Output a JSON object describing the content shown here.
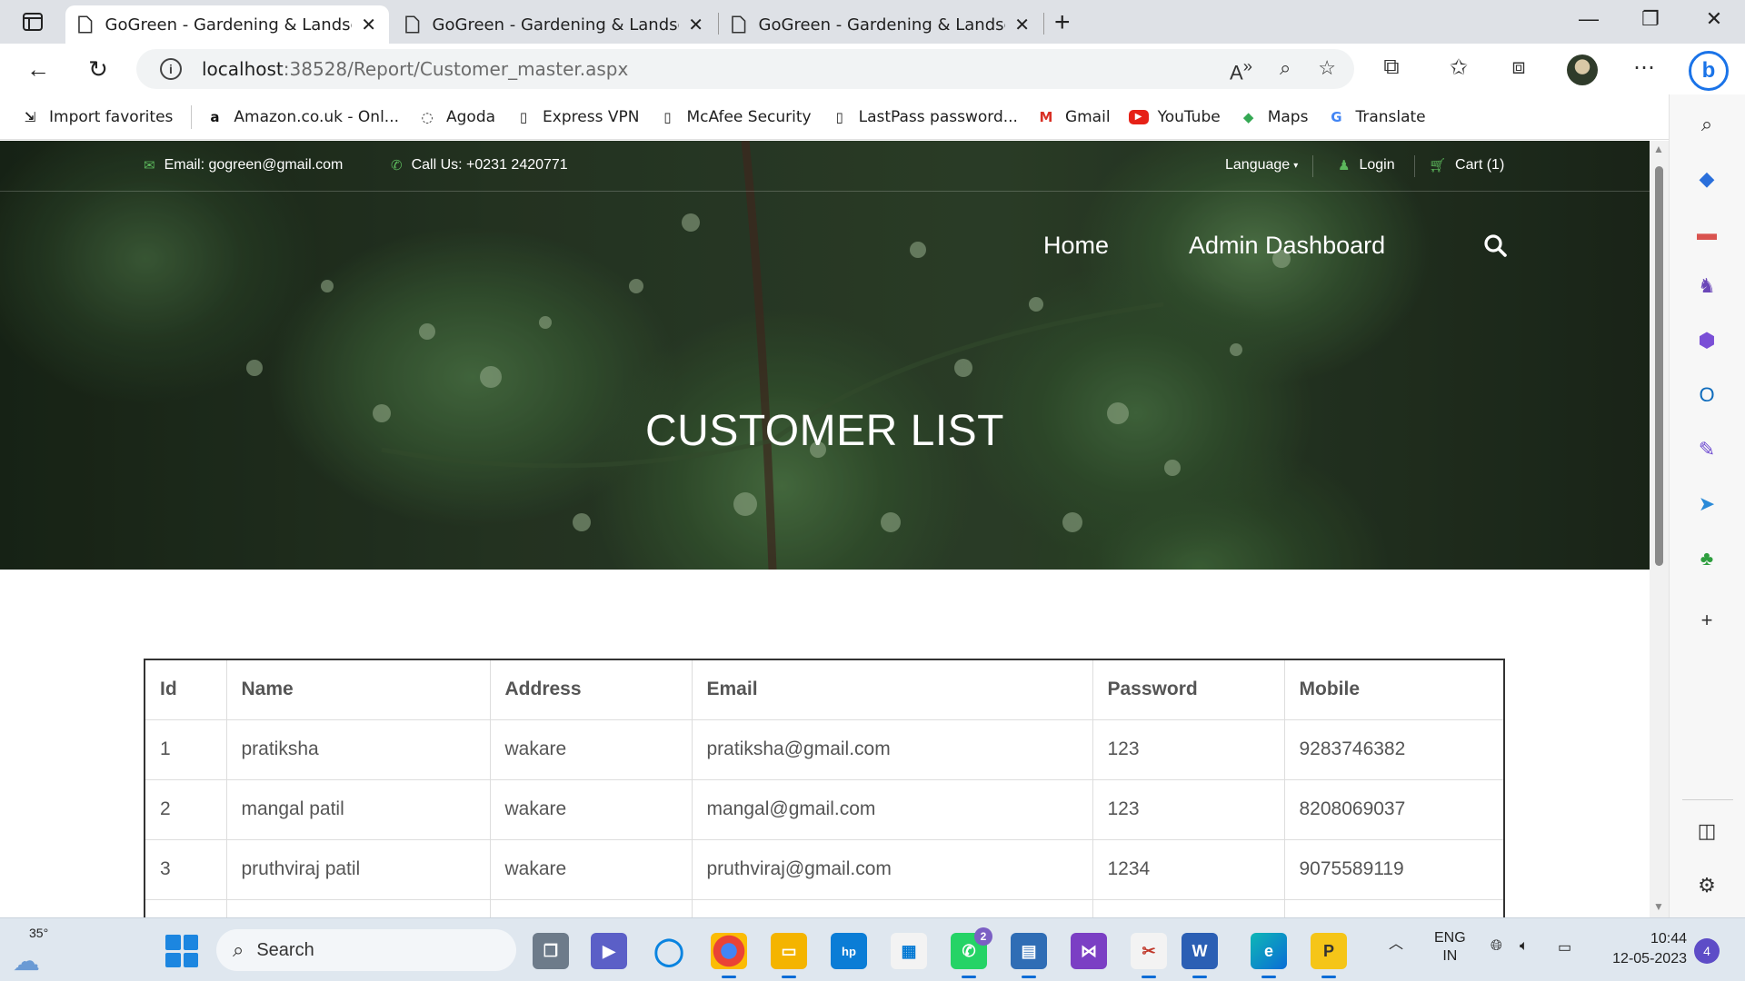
{
  "browser": {
    "tabs": [
      {
        "title": "GoGreen - Gardening & Landsca",
        "active": true
      },
      {
        "title": "GoGreen - Gardening & Landsca",
        "active": false
      },
      {
        "title": "GoGreen - Gardening & Landsca",
        "active": false
      }
    ],
    "new_tab": "+",
    "url_host": "localhost",
    "url_path": ":38528/Report/Customer_master.aspx",
    "favorites": [
      {
        "label": "Import favorites",
        "icon": "import-icon"
      },
      {
        "label": "Amazon.co.uk - Onl...",
        "icon": "amazon-icon"
      },
      {
        "label": "Agoda",
        "icon": "agoda-icon"
      },
      {
        "label": "Express VPN",
        "icon": "page-icon"
      },
      {
        "label": "McAfee Security",
        "icon": "page-icon"
      },
      {
        "label": "LastPass password...",
        "icon": "page-icon"
      },
      {
        "label": "Gmail",
        "icon": "gmail-icon"
      },
      {
        "label": "YouTube",
        "icon": "youtube-icon"
      },
      {
        "label": "Maps",
        "icon": "maps-icon"
      },
      {
        "label": "Translate",
        "icon": "translate-icon"
      }
    ]
  },
  "site": {
    "topbar": {
      "email": "Email: gogreen@gmail.com",
      "phone": "Call Us: +0231 2420771",
      "language": "Language",
      "login": "Login",
      "cart": "Cart (1)"
    },
    "nav": {
      "home": "Home",
      "admin": "Admin Dashboard"
    },
    "hero_title": "CUSTOMER LIST",
    "accent_color": "#5cb85c"
  },
  "customer_table": {
    "columns": [
      "Id",
      "Name",
      "Address",
      "Email",
      "Password",
      "Mobile"
    ],
    "rows": [
      [
        "1",
        "pratiksha",
        "wakare",
        "pratiksha@gmail.com",
        "123",
        "9283746382"
      ],
      [
        "2",
        "mangal patil",
        "wakare",
        "mangal@gmail.com",
        "123",
        "8208069037"
      ],
      [
        "3",
        "pruthviraj patil",
        "wakare",
        "pruthviraj@gmail.com",
        "1234",
        "9075589119"
      ],
      [
        "",
        "",
        "",
        "",
        "",
        ""
      ]
    ]
  },
  "taskbar": {
    "temperature": "35°",
    "search_label": "Search",
    "whatsapp_badge": "2",
    "lang_top": "ENG",
    "lang_bottom": "IN",
    "time": "10:44",
    "date": "12-05-2023",
    "notifications": "4"
  }
}
